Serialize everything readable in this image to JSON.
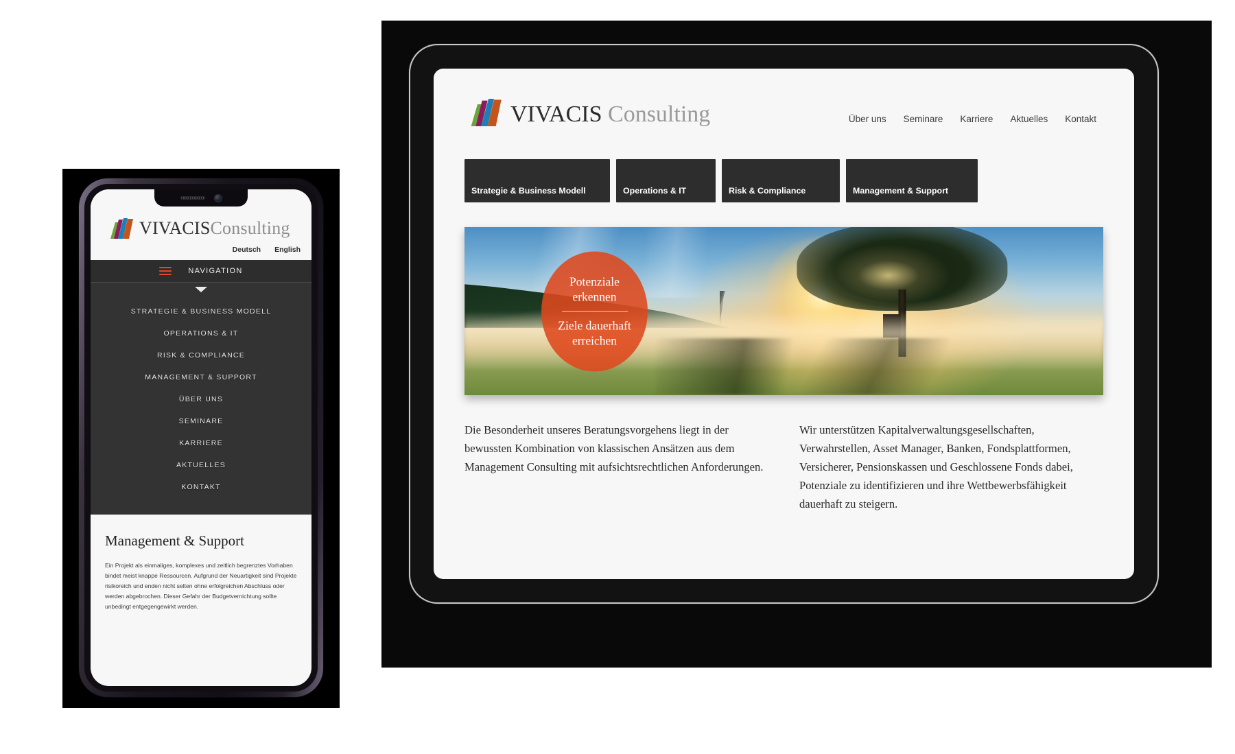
{
  "brand": {
    "name_bold": "VIVACIS",
    "name_light": "Consulting",
    "logo_colors": [
      "#6aa43c",
      "#8e1a5e",
      "#1d7fb8",
      "#c4541a"
    ],
    "accent_orange": "#de481d",
    "dark_bar": "#2d2d2d"
  },
  "phone": {
    "lang_links": [
      "Deutsch",
      "English"
    ],
    "nav_toggle_label": "NAVIGATION",
    "nav_toggle_icon": "hamburger-icon",
    "menu_items": [
      "STRATEGIE & BUSINESS MODELL",
      "OPERATIONS & IT",
      "RISK & COMPLIANCE",
      "MANAGEMENT & SUPPORT",
      "ÜBER UNS",
      "SEMINARE",
      "KARRIERE",
      "AKTUELLES",
      "KONTAKT"
    ],
    "content": {
      "heading": "Management & Support",
      "paragraph": "Ein Projekt als einmaliges, komplexes und zeitlich begrenztes Vorhaben bindet meist knappe Ressourcen. Aufgrund der Neuartigkeit sind Projekte risikoreich und enden nicht selten ohne erfolgreichen Abschluss oder werden abgebrochen. Dieser Gefahr der Budgetvernichtung sollte unbedingt entgegengewirkt werden."
    },
    "hardware": {
      "speaker_icon": "speaker-grille-icon",
      "camera_icon": "front-camera-icon"
    }
  },
  "tablet": {
    "top_nav": [
      "Über uns",
      "Seminare",
      "Karriere",
      "Aktuelles",
      "Kontakt"
    ],
    "tiles": [
      "Strategie & Business Modell",
      "Operations & IT",
      "Risk & Compliance",
      "Management & Support"
    ],
    "hero": {
      "badge_line_1": "Potenziale\nerkennen",
      "badge_line_1_a": "Potenziale",
      "badge_line_1_b": "erkennen",
      "badge_line_2_a": "Ziele dauerhaft",
      "badge_line_2_b": "erreichen",
      "image_description": "sunrise-landscape-with-tree-photo"
    },
    "columns": [
      "Die Besonderheit unseres Beratungsvorgehens liegt in der bewussten Kombination von klassischen Ansätzen aus dem Management Consulting mit aufsichtsrechtlichen Anforderungen.",
      "Wir unterstützen Kapitalverwaltungsgesellschaften, Verwahrstellen, Asset Manager, Banken, Fondsplattformen, Versicherer, Pensionskassen und Geschlossene Fonds dabei, Potenziale zu identifizieren und ihre Wettbewerbsfähigkeit dauerhaft zu steigern."
    ]
  }
}
